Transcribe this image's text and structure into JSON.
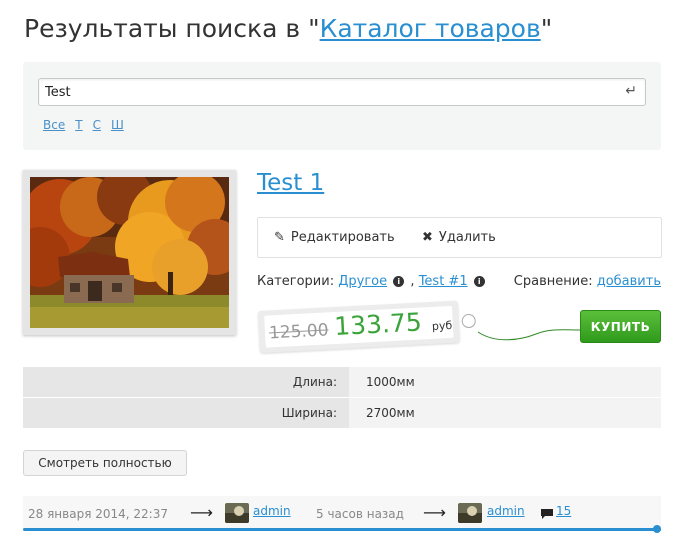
{
  "header": {
    "title_prefix": "Результаты поиска в \"",
    "catalog_link": "Каталог товаров",
    "title_suffix": "\""
  },
  "search": {
    "value": "Test",
    "enter_icon": "return-icon",
    "letters": [
      "Все",
      "Т",
      "С",
      "Ш"
    ]
  },
  "product": {
    "title": "Test 1",
    "image_icon": "autumn-cabin-photo",
    "actions": {
      "edit_label": "Редактировать",
      "delete_label": "Удалить"
    },
    "categories_label": "Категории:",
    "categories": [
      "Другое",
      "Test #1"
    ],
    "separator": ",",
    "compare_label": "Сравнение:",
    "compare_link": "добавить",
    "old_price": "125.00",
    "price": "133.75",
    "currency": "руб",
    "buy_label": "КУПИТЬ",
    "specs": [
      {
        "name": "Длина:",
        "value": "1000мм"
      },
      {
        "name": "Ширина:",
        "value": "2700мм"
      }
    ],
    "view_full_label": "Смотреть полностью"
  },
  "footer": {
    "created": "28 января 2014, 22:37",
    "created_by": "admin",
    "updated": "5 часов назад",
    "updated_by": "admin",
    "comments": "15",
    "arrow": "⟶"
  },
  "colors": {
    "link": "#2a8fd0",
    "price": "#3aa33a",
    "buy_button": "#3aa52a"
  }
}
